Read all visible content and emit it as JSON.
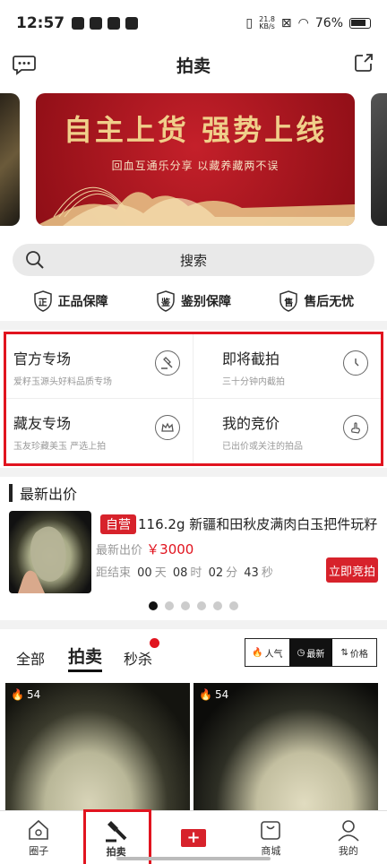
{
  "status": {
    "time": "12:57",
    "net_speed": "21.8",
    "net_unit": "KB/s",
    "battery": "76%"
  },
  "header": {
    "title": "拍卖"
  },
  "banner": {
    "title": "自主上货 强势上线",
    "subtitle": "回血互通乐分享 以藏养藏两不误"
  },
  "search": {
    "label": "搜索"
  },
  "guarantees": [
    {
      "glyph": "正",
      "label": "正品保障"
    },
    {
      "glyph": "鉴",
      "label": "鉴别保障"
    },
    {
      "glyph": "售",
      "label": "售后无忧"
    }
  ],
  "features": [
    {
      "title": "官方专场",
      "subtitle": "爱籽玉源头好料品质专场",
      "icon": "gavel-icon"
    },
    {
      "title": "即将截拍",
      "subtitle": "三十分钟内截拍",
      "icon": "clock-icon"
    },
    {
      "title": "藏友专场",
      "subtitle": "玉友珍藏美玉 严选上拍",
      "icon": "crown-icon"
    },
    {
      "title": "我的竞价",
      "subtitle": "已出价或关注的拍品",
      "icon": "bid-hand-icon"
    }
  ],
  "latest": {
    "heading": "最新出价",
    "tag": "自营",
    "name": "116.2g 新疆和田秋皮满肉白玉把件玩籽",
    "price_label": "最新出价",
    "price": "￥3000",
    "countdown_label": "距结束",
    "days": "00",
    "days_unit": "天",
    "hours": "08",
    "hours_unit": "时",
    "minutes": "02",
    "minutes_unit": "分",
    "seconds": "43",
    "seconds_unit": "秒",
    "bid_button": "立即竞拍",
    "carousel_dots": 6,
    "carousel_active": 0
  },
  "tabs": {
    "all": "全部",
    "auction": "拍卖",
    "flash": "秒杀"
  },
  "sort": {
    "popular": "人气",
    "newest": "最新",
    "price": "价格"
  },
  "cards": [
    {
      "hot": "54"
    },
    {
      "hot": "54"
    }
  ],
  "nav": [
    {
      "label": "圈子",
      "icon": "home-icon"
    },
    {
      "label": "拍卖",
      "icon": "gavel-icon"
    },
    {
      "label": "",
      "icon": "plus-icon"
    },
    {
      "label": "商城",
      "icon": "bag-icon"
    },
    {
      "label": "我的",
      "icon": "person-icon"
    }
  ],
  "colors": {
    "accent": "#d7222b",
    "highlight": "#e1141f",
    "banner": "#b01822",
    "gold": "#f0cf8a"
  }
}
